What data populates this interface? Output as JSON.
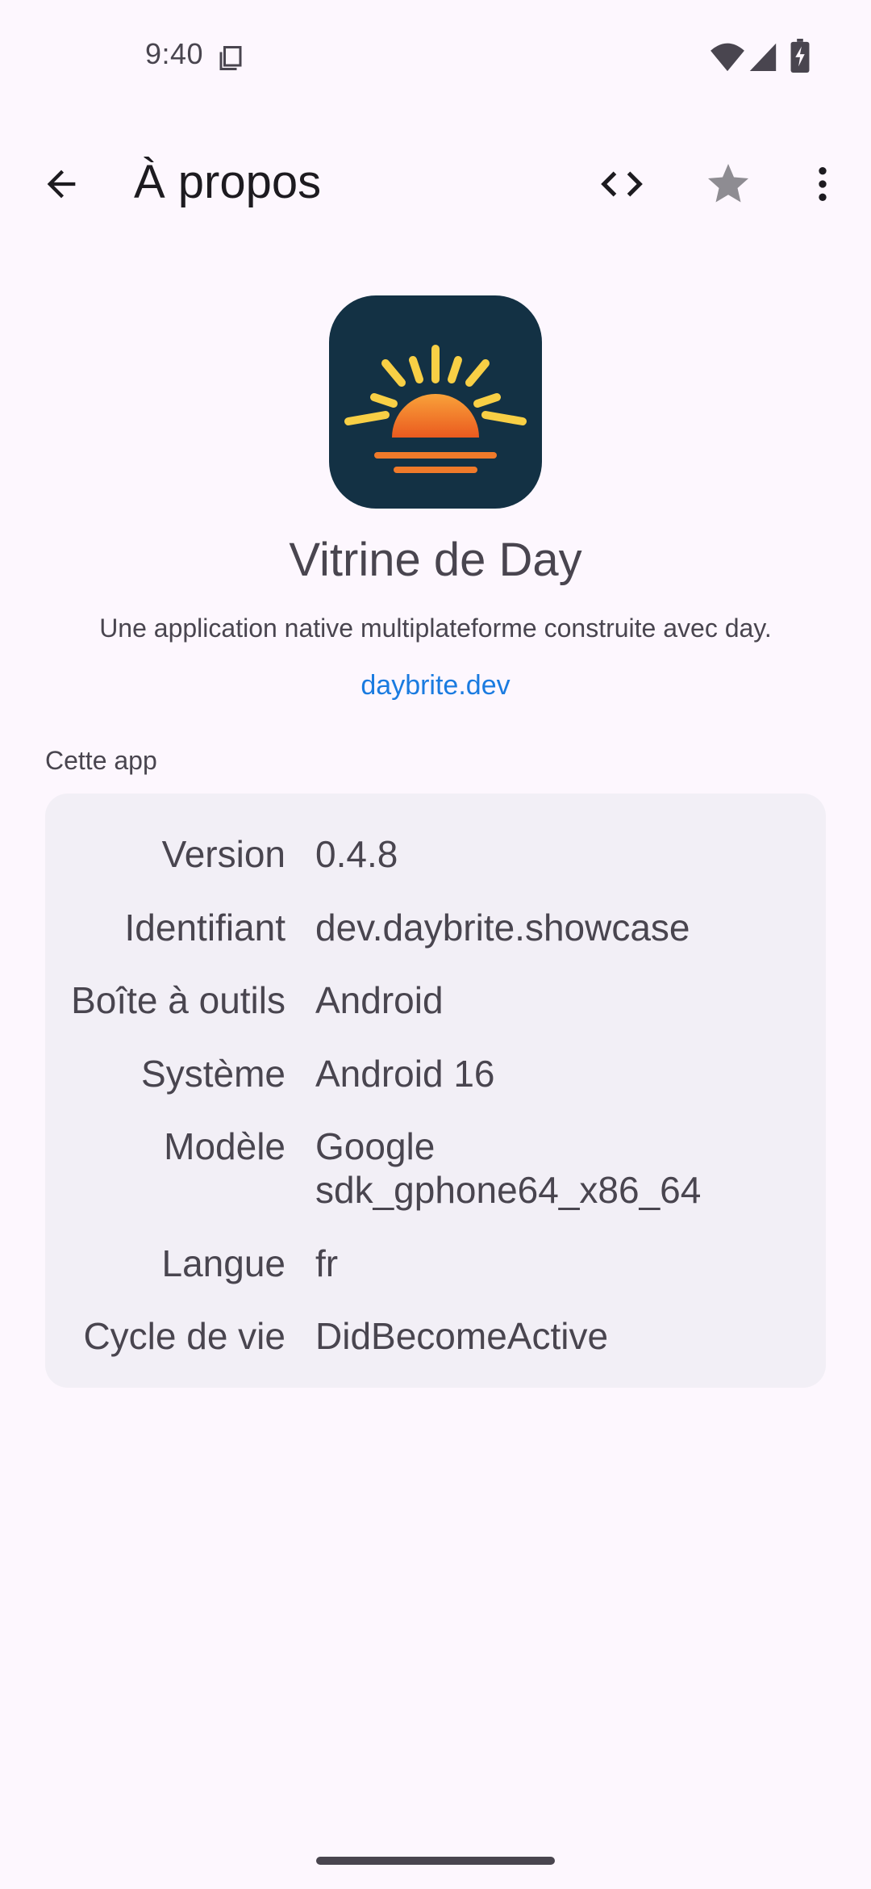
{
  "status_bar": {
    "time": "9:40",
    "icons": [
      "clipboard-icon",
      "wifi-icon",
      "signal-icon",
      "battery-charging-icon"
    ]
  },
  "app_bar": {
    "title": "À propos",
    "icons": [
      "back-arrow-icon",
      "code-icon",
      "star-icon",
      "more-vert-icon"
    ]
  },
  "header": {
    "app_name": "Vitrine de Day",
    "description": "Une application native multiplateforme construite avec day.",
    "link": "daybrite.dev"
  },
  "section": {
    "label": "Cette app"
  },
  "info_rows": [
    {
      "key": "Version",
      "value": "0.4.8"
    },
    {
      "key": "Identifiant",
      "value": "dev.daybrite.showcase"
    },
    {
      "key": "Boîte à outils",
      "value": "Android"
    },
    {
      "key": "Système",
      "value": "Android 16"
    },
    {
      "key": "Modèle",
      "value": "Google sdk_gphone64_x86_64"
    },
    {
      "key": "Langue",
      "value": "fr"
    },
    {
      "key": "Cycle de vie",
      "value": "DidBecomeActive"
    }
  ],
  "colors": {
    "background": "#fdf7fe",
    "card": "#f2eff6",
    "link": "#1a7be0",
    "icon_bg": "#133144",
    "sun_yellow": "#f8cf45",
    "sun_orange": "#f07a2a"
  }
}
